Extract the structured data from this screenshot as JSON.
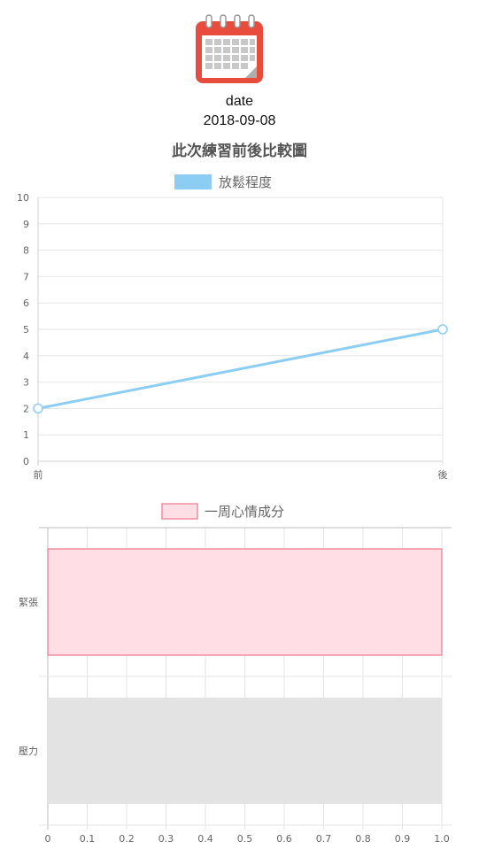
{
  "header": {
    "icon": "calendar-icon",
    "date_label": "date",
    "date_value": "2018-09-08",
    "title": "此次練習前後比較圖"
  },
  "colors": {
    "calendar_red": "#E74C3C",
    "line_series": "#8CCEF3",
    "bar_pink_fill": "#FFDFE5",
    "bar_pink_border": "#F08DA0",
    "bar_gray_fill": "#E3E3E3",
    "grid": "#E6E6E6",
    "tick_text": "#666666"
  },
  "chart_data": [
    {
      "type": "line",
      "legend": "放鬆程度",
      "legend_position": "top",
      "categories": [
        "前",
        "後"
      ],
      "series": [
        {
          "name": "放鬆程度",
          "values": [
            2,
            5
          ]
        }
      ],
      "ylim": [
        0,
        10
      ],
      "yticks": [
        "0",
        "1",
        "2",
        "3",
        "4",
        "5",
        "6",
        "7",
        "8",
        "9",
        "10"
      ],
      "grid": true
    },
    {
      "type": "bar",
      "orientation": "horizontal",
      "legend": "一周心情成分",
      "legend_position": "top",
      "categories": [
        "緊張",
        "壓力"
      ],
      "series": [
        {
          "name": "一周心情成分",
          "values": [
            1.0,
            1.0
          ]
        }
      ],
      "xlim": [
        0,
        1.0
      ],
      "xticks": [
        "0",
        "0.1",
        "0.2",
        "0.3",
        "0.4",
        "0.5",
        "0.6",
        "0.7",
        "0.8",
        "0.9",
        "1.0"
      ],
      "grid": true
    }
  ]
}
